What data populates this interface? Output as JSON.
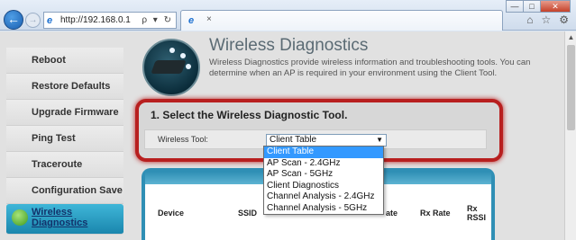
{
  "browser": {
    "url": "http://192.168.0.1",
    "addr_tools": "ρ ▾ ↻",
    "tab_close": "×",
    "win_min": "—",
    "win_max": "□",
    "win_close": "✕",
    "back": "←",
    "forward": "→",
    "icons": [
      "home-icon",
      "star-icon",
      "gear-icon"
    ]
  },
  "sidebar": {
    "items": [
      {
        "label": "Reboot"
      },
      {
        "label": "Restore Defaults"
      },
      {
        "label": "Upgrade Firmware"
      },
      {
        "label": "Ping Test"
      },
      {
        "label": "Traceroute"
      },
      {
        "label": "Configuration Save"
      }
    ],
    "active": {
      "label_line1": "Wireless",
      "label_line2": "Diagnostics"
    }
  },
  "header": {
    "title": "Wireless Diagnostics",
    "description": "Wireless Diagnostics provide wireless information and troubleshooting tools. You can determine when an AP is required in your environment using the Client Tool."
  },
  "tool_section": {
    "heading": "1. Select the Wireless Diagnostic Tool.",
    "label": "Wireless Tool:",
    "selected": "Client Table",
    "options": [
      "Client Table",
      "AP Scan - 2.4GHz",
      "AP Scan - 5GHz",
      "Client Diagnostics",
      "Channel Analysis - 2.4GHz",
      "Channel Analysis - 5GHz"
    ]
  },
  "table": {
    "headers": {
      "device": "Device",
      "ssid": "SSID",
      "tx_rate_tail": "ate",
      "rx_rate": "Rx Rate",
      "rx_rssi_1": "Rx",
      "rx_rssi_2": "RSSI"
    }
  },
  "colors": {
    "accent_red": "#b81f1f",
    "accent_blue": "#2f8fb5",
    "selection": "#3399ff"
  }
}
